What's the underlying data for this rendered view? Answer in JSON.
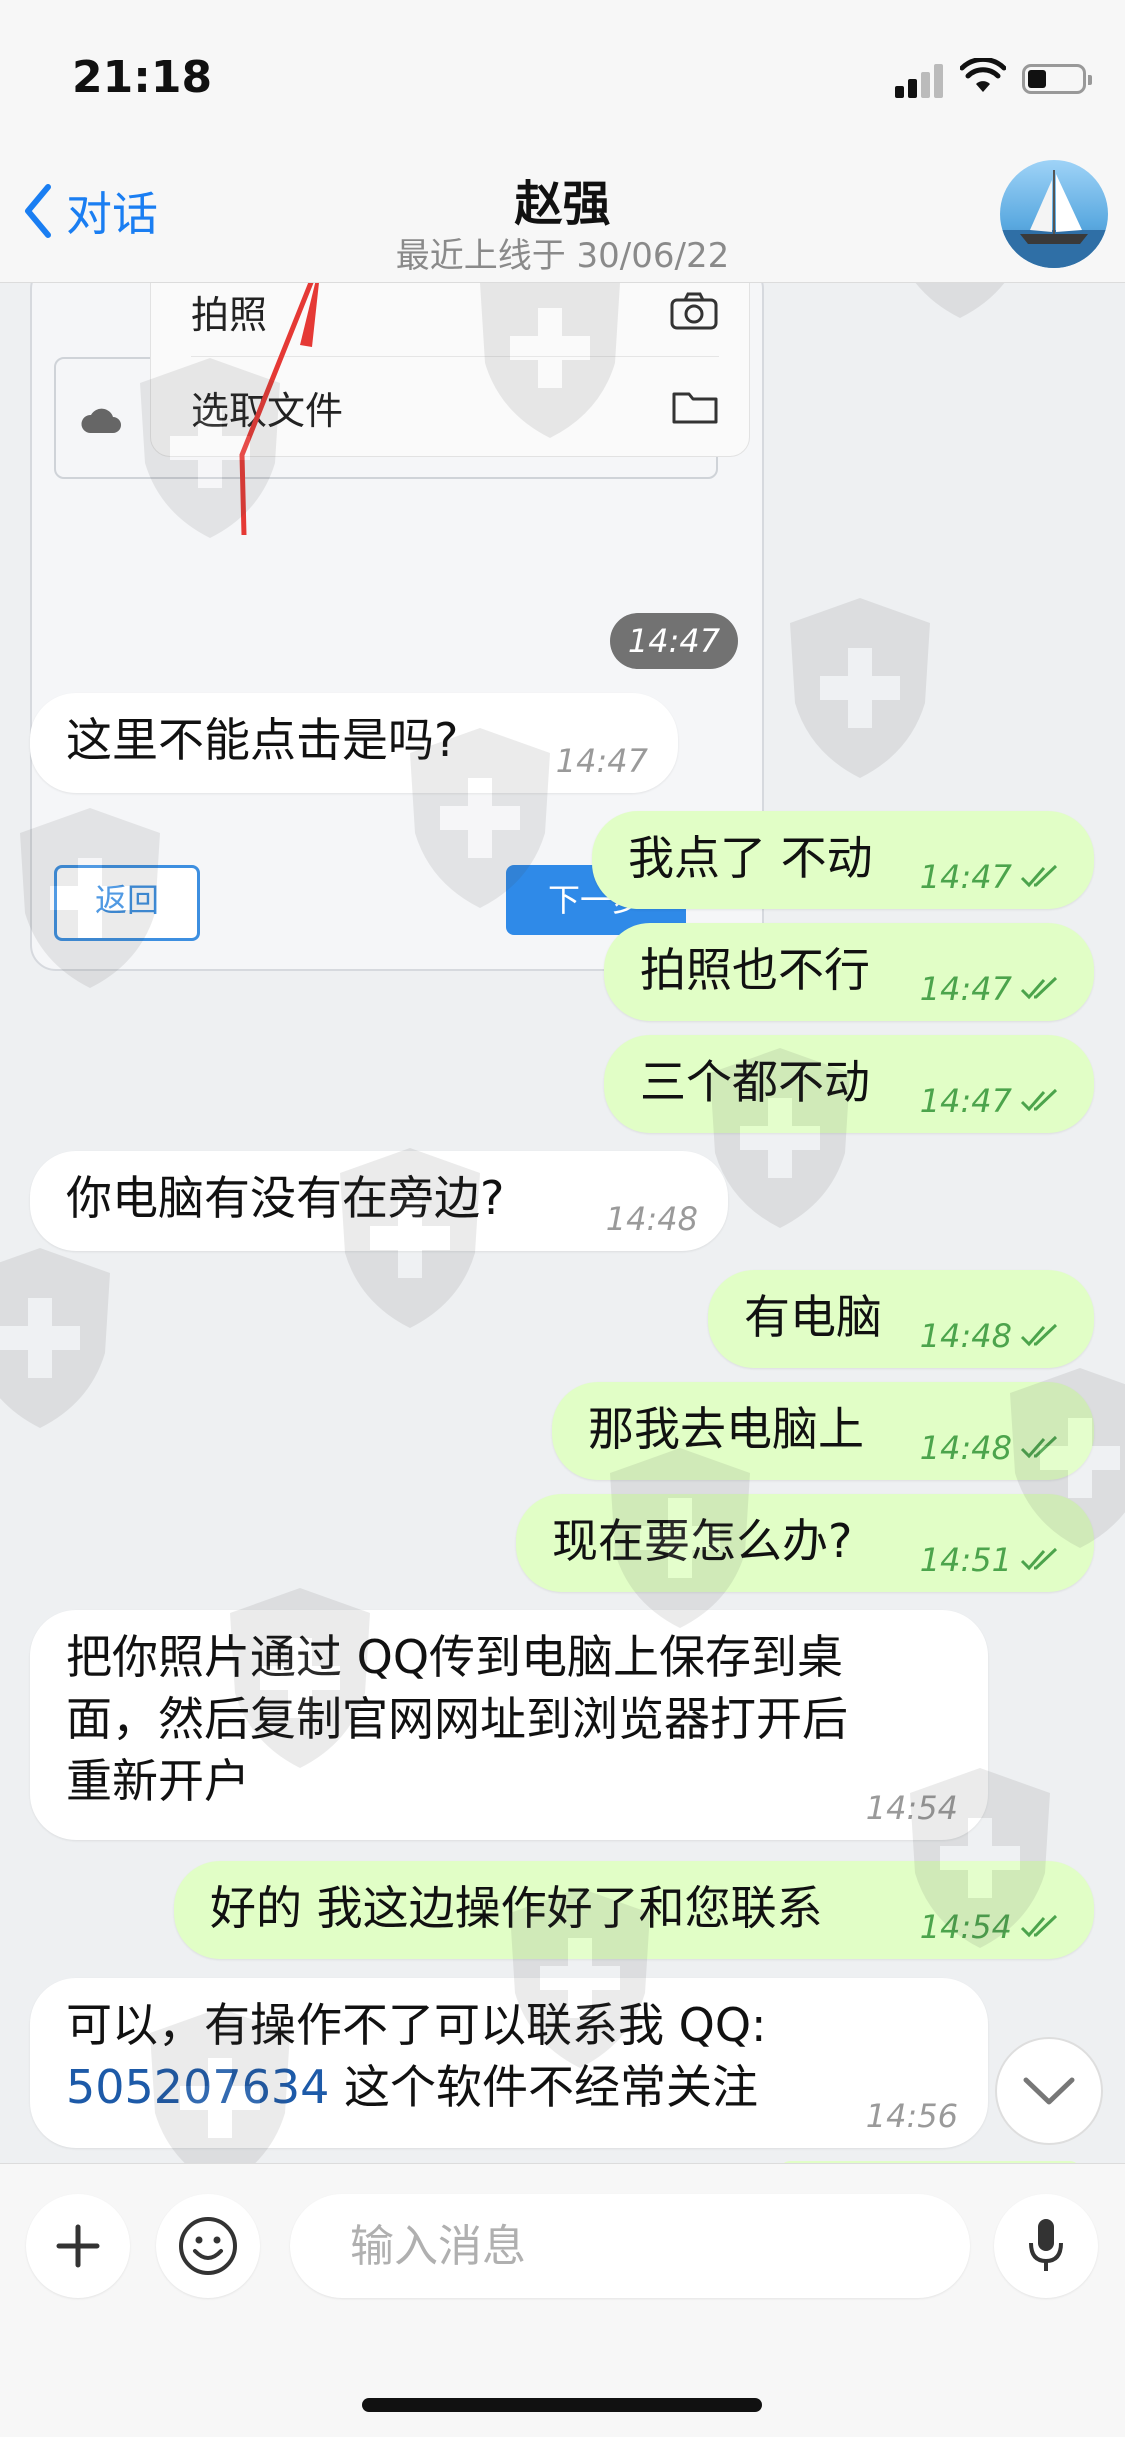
{
  "status_bar": {
    "time": "21:18"
  },
  "header": {
    "back_label": "对话",
    "contact_name": "赵强",
    "last_seen": "最近上线于 30/06/22"
  },
  "image_message": {
    "menu_take_photo": "拍照",
    "menu_choose_file": "选取文件",
    "back_button": "返回",
    "next_button": "下一步",
    "time": "14:47"
  },
  "messages": [
    {
      "dir": "in",
      "text": "这里不能点击是吗?",
      "time": "14:47"
    },
    {
      "dir": "out",
      "text": "我点了 不动",
      "time": "14:47"
    },
    {
      "dir": "out",
      "text": "拍照也不行",
      "time": "14:47"
    },
    {
      "dir": "out",
      "text": "三个都不动",
      "time": "14:47"
    },
    {
      "dir": "in",
      "text": "你电脑有没有在旁边?",
      "time": "14:48"
    },
    {
      "dir": "out",
      "text": "有电脑",
      "time": "14:48"
    },
    {
      "dir": "out",
      "text": "那我去电脑上",
      "time": "14:48"
    },
    {
      "dir": "out",
      "text": "现在要怎么办?",
      "time": "14:51"
    },
    {
      "dir": "in",
      "lines": [
        "把你照片通过 QQ传到电脑上保存到桌",
        "面，然后复制官网网址到浏览器打开后",
        "重新开户"
      ],
      "time": "14:54"
    },
    {
      "dir": "out",
      "text": "好的 我这边操作好了和您联系",
      "time": "14:54"
    },
    {
      "dir": "in",
      "line1": "可以，有操作不了可以联系我 QQ:",
      "qq_number": "505207634",
      "line2_rest": "这个软件不经常关注",
      "time": "14:56"
    }
  ],
  "input": {
    "placeholder": "输入消息"
  },
  "icons": {
    "back": "chevron-left-icon",
    "attach": "plus-icon",
    "emoji": "smiley-icon",
    "voice": "microphone-icon",
    "scroll": "chevron-down-icon",
    "read_receipt": "double-check-icon"
  },
  "colors": {
    "accent": "#1a7ef2",
    "outgoing_bubble": "#e1fec6",
    "incoming_bubble": "#ffffff",
    "read_check": "#4ca44c",
    "link": "#1d5aa8"
  }
}
